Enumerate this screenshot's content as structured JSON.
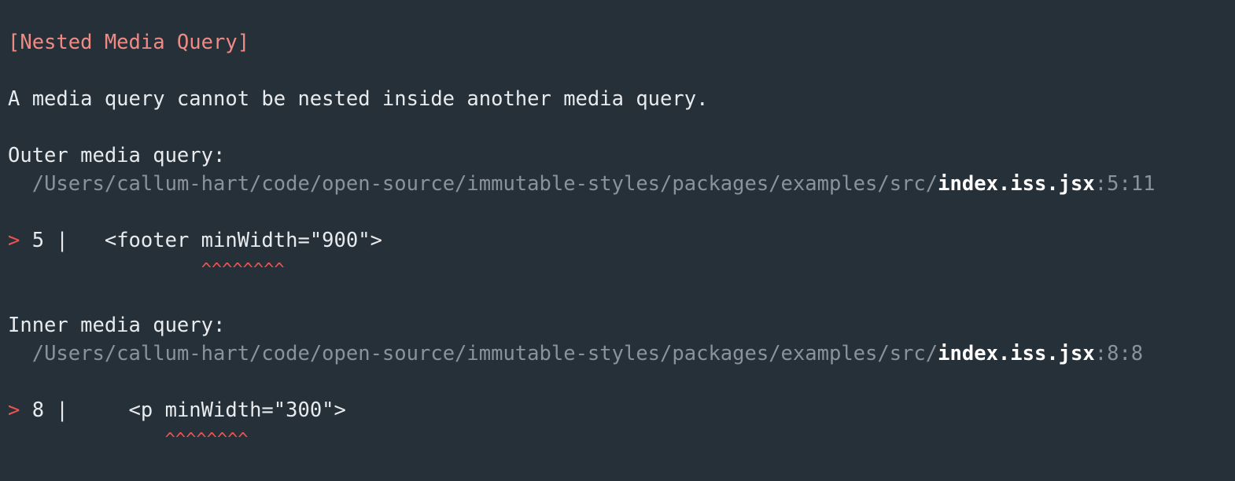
{
  "error": {
    "title": "[Nested Media Query]",
    "message": "A media query cannot be nested inside another media query."
  },
  "outer": {
    "label": "Outer media query:",
    "indent": "  ",
    "path_dir": "/Users/callum-hart/code/open-source/immutable-styles/packages/examples/src/",
    "file": "index.iss.jsx",
    "location": ":5:11",
    "marker": ">",
    "line_no": " 5 |",
    "code": "   <footer minWidth=\"900\">",
    "caret_indent": "                ",
    "caret": "^^^^^^^^"
  },
  "inner": {
    "label": "Inner media query:",
    "indent": "  ",
    "path_dir": "/Users/callum-hart/code/open-source/immutable-styles/packages/examples/src/",
    "file": "index.iss.jsx",
    "location": ":8:8",
    "marker": ">",
    "line_no": " 8 |",
    "code": "     <p minWidth=\"300\">",
    "caret_indent": "             ",
    "caret": "^^^^^^^^"
  },
  "colors": {
    "background": "#263038",
    "title": "#f08a85",
    "text": "#e8ebee",
    "dim": "#8a939b",
    "error_marker": "#ef5350"
  }
}
